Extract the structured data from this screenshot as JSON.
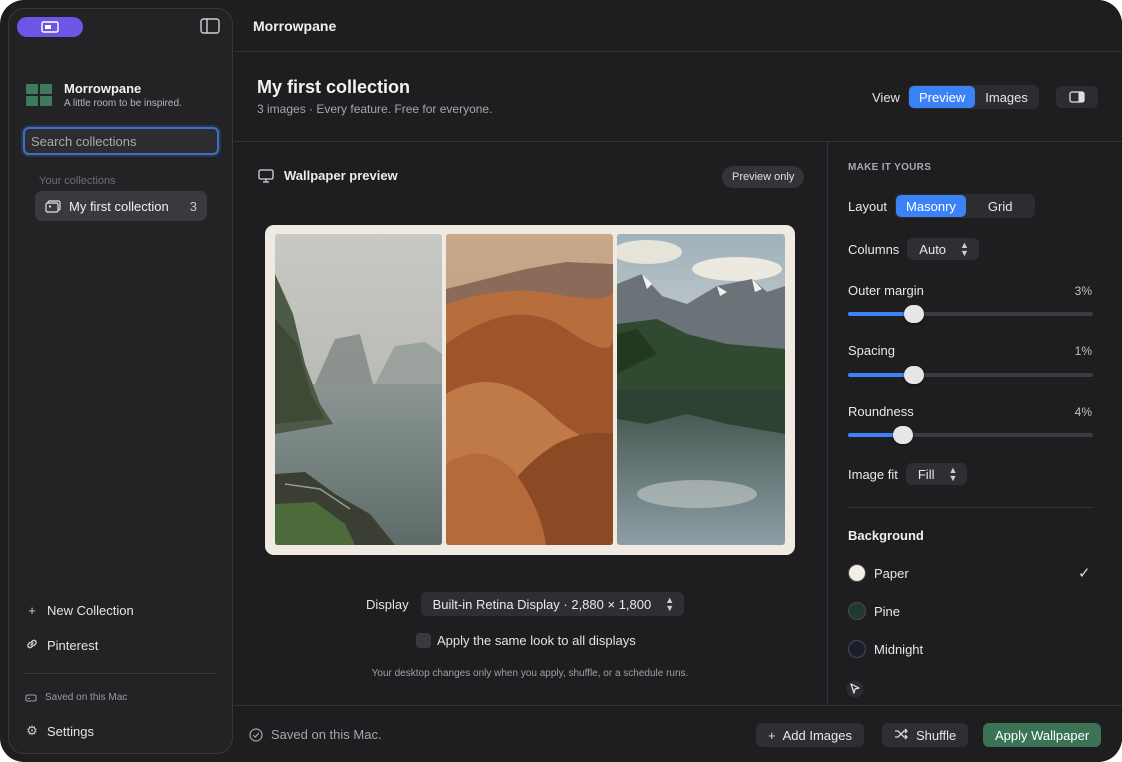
{
  "app": {
    "title": "Morrowpane"
  },
  "sidebar": {
    "brand_name": "Morrowpane",
    "brand_tagline": "A little room to be inspired.",
    "search_placeholder": "Search collections",
    "section_label": "Your collections",
    "collections": [
      {
        "label": "My first collection",
        "count": "3"
      }
    ],
    "new_collection": "New Collection",
    "pinterest": "Pinterest",
    "saved": "Saved on this Mac",
    "settings": "Settings"
  },
  "collection": {
    "title": "My first collection",
    "subtitle": "3 images · Every feature. Free for everyone.",
    "view_label": "View",
    "view_options": [
      "Preview",
      "Images"
    ],
    "view_selected": "Preview"
  },
  "preview": {
    "header": "Wallpaper preview",
    "chip": "Preview only",
    "display_label": "Display",
    "display_value": "Built-in Retina Display · 2,880 × 1,800",
    "apply_all_label": "Apply the same look to all displays",
    "apply_all_checked": false,
    "note": "Your desktop changes only when you apply, shuffle, or a schedule runs.",
    "images": [
      "coastal cliffs in mist",
      "desert sand dunes",
      "mountain lake reflection"
    ]
  },
  "settings": {
    "section": "MAKE IT YOURS",
    "layout_label": "Layout",
    "layout_options": [
      "Masonry",
      "Grid"
    ],
    "layout_selected": "Masonry",
    "columns_label": "Columns",
    "columns_value": "Auto",
    "outer_margin": {
      "label": "Outer margin",
      "value": "3%",
      "level": 0.27
    },
    "spacing": {
      "label": "Spacing",
      "value": "1%",
      "level": 0.27
    },
    "roundness": {
      "label": "Roundness",
      "value": "4%",
      "level": 0.225
    },
    "image_fit_label": "Image fit",
    "image_fit_value": "Fill",
    "background_label": "Background",
    "backgrounds": [
      {
        "name": "Paper",
        "color": "#f3efe6",
        "selected": true
      },
      {
        "name": "Pine",
        "color": "#1f3b30",
        "selected": false
      },
      {
        "name": "Midnight",
        "color": "#1a1d2c",
        "selected": false
      }
    ]
  },
  "footer": {
    "saved": "Saved on this Mac.",
    "add_images": "Add Images",
    "shuffle": "Shuffle",
    "apply": "Apply Wallpaper"
  },
  "colors": {
    "accent": "#3b82f6",
    "primary_button": "#3a7355",
    "brand_pill": "#6b56e6"
  }
}
